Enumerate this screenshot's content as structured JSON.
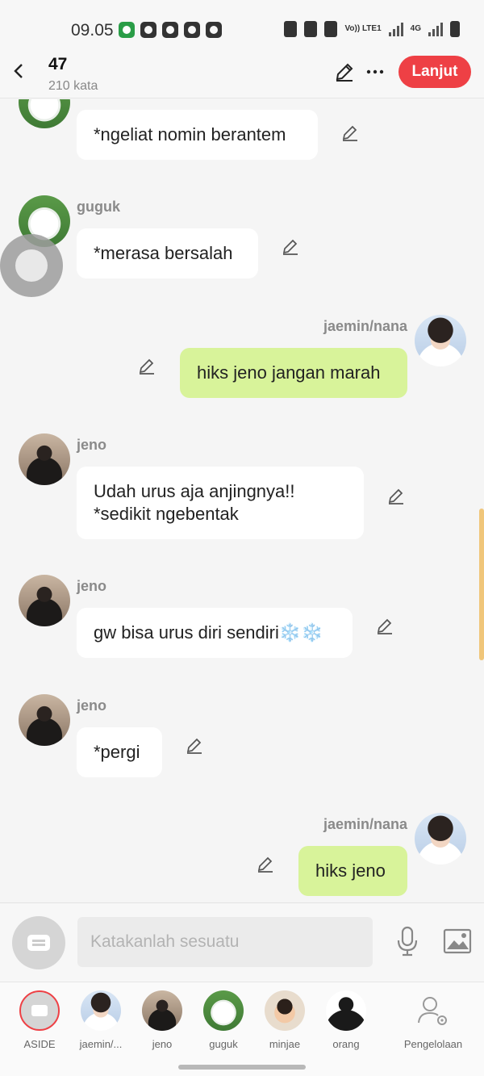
{
  "status_bar": {
    "time": "09.05",
    "network_label": "Vo)) LTE1",
    "network_type": "4G"
  },
  "header": {
    "title": "47",
    "word_count": "210 kata",
    "continue_label": "Lanjut"
  },
  "messages": [
    {
      "sender": "",
      "avatar": "dog",
      "text": "*ngeliat nomin berantem",
      "side": "left"
    },
    {
      "sender": "guguk",
      "avatar": "dog",
      "text": "*merasa bersalah",
      "side": "left"
    },
    {
      "sender": "jaemin/nana",
      "avatar": "jaemin",
      "text": "hiks jeno jangan marah",
      "side": "right"
    },
    {
      "sender": "jeno",
      "avatar": "jeno",
      "text": "Udah urus aja anjingnya!!\n*sedikit ngebentak",
      "side": "left"
    },
    {
      "sender": "jeno",
      "avatar": "jeno",
      "text": "gw bisa urus diri sendiri❄️❄️",
      "side": "left"
    },
    {
      "sender": "jeno",
      "avatar": "jeno",
      "text": "*pergi",
      "side": "left"
    },
    {
      "sender": "jaemin/nana",
      "avatar": "jaemin",
      "text": "hiks jeno",
      "side": "right"
    }
  ],
  "input": {
    "placeholder": "Katakanlah sesuatu"
  },
  "characters": [
    {
      "label": "ASIDE"
    },
    {
      "label": "jaemin/..."
    },
    {
      "label": "jeno"
    },
    {
      "label": "guguk"
    },
    {
      "label": "minjae"
    },
    {
      "label": "orang"
    },
    {
      "label": "Pengelolaan"
    }
  ],
  "colors": {
    "accent": "#ee4045",
    "my_bubble": "#d8f39a",
    "other_bubble": "#ffffff"
  }
}
